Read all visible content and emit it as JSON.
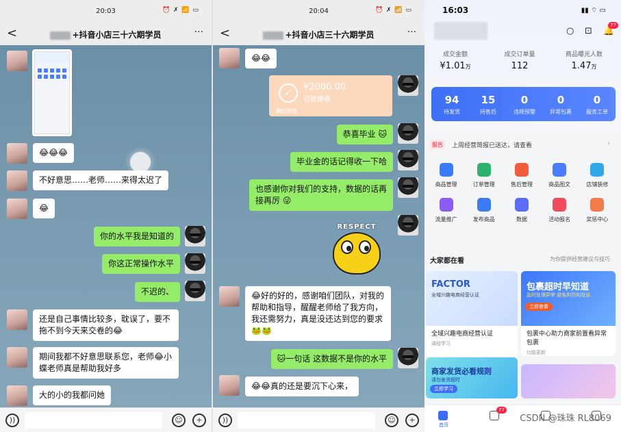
{
  "chat1": {
    "time": "20:03",
    "status_icons": "⏰ ✗ 📶 ▭",
    "title": "+抖音小店三十六期学员",
    "back": "<",
    "more": "···",
    "messages": [
      {
        "text": "😂😂😂"
      },
      {
        "text": "不好意思……老师……来得太迟了"
      },
      {
        "text": "😂"
      },
      {
        "text": "你的水平我是知道的"
      },
      {
        "text": "你这正常操作水平"
      },
      {
        "text": "不迟的、"
      },
      {
        "text": "还是自己事情比较多，耽误了，要不拖不到今天来交卷的😂"
      },
      {
        "text": "期间我都不好意思联系您，老师😂小蝶老师真是帮助我好多"
      },
      {
        "text": "大的小的我都问她"
      }
    ]
  },
  "chat2": {
    "time": "20:04",
    "status_icons": "⏰ ✗ 📶 ▭",
    "title": "+抖音小店三十六期学员",
    "back": "<",
    "more": "···",
    "first": "😂😂",
    "transfer": {
      "amount": "¥2000.00",
      "status": "已被接收",
      "footer": "微信转账"
    },
    "messages": [
      {
        "text": "恭喜毕业 🐱"
      },
      {
        "text": "毕业金的话记得收一下哈"
      },
      {
        "text": "也感谢你对我们的支持，数据的话再接再厉 😜"
      },
      {
        "text": "😂好的好的，感谢咱们团队，对我的帮助和指导，醒醒老师给了我方向，我还需努力，真是没还达到您的要求🐸🐸"
      },
      {
        "text": "🐱一句话 这数据不是你的水平"
      },
      {
        "text": "😂😂真的还是要沉下心来，"
      }
    ],
    "sticker_word": "RESPECT"
  },
  "input": {
    "voice": "))",
    "emoji": "☺",
    "plus": "+"
  },
  "app": {
    "time": "16:03",
    "status_icons": "▮▮ ⌔ ▭",
    "top_icons": [
      "○",
      "⊡",
      "🔔"
    ],
    "badge": "77",
    "metrics": [
      {
        "label": "成交金额",
        "value": "¥1.01",
        "unit": "万"
      },
      {
        "label": "成交订单量",
        "value": "112",
        "unit": ""
      },
      {
        "label": "商品曝光人数",
        "value": "1.47",
        "unit": "万"
      }
    ],
    "stats": [
      {
        "n": "94",
        "t": "待发货"
      },
      {
        "n": "15",
        "t": "待售后"
      },
      {
        "n": "0",
        "t": "违规预警"
      },
      {
        "n": "0",
        "t": "异常包裹"
      },
      {
        "n": "0",
        "t": "服务工单"
      }
    ],
    "notice": {
      "tag": "报告",
      "text": "上周经营简报已送达，请查看",
      "arrow": "›"
    },
    "tiles": [
      {
        "label": "商品管理",
        "color": "#3b7cf6"
      },
      {
        "label": "订单管理",
        "color": "#2db36b"
      },
      {
        "label": "售后管理",
        "color": "#f25c3c"
      },
      {
        "label": "商品图文",
        "color": "#4a7dfc"
      },
      {
        "label": "店铺装修",
        "color": "#2fa6e8"
      },
      {
        "label": "流量推广",
        "color": "#8a5cf5"
      },
      {
        "label": "发布商品",
        "color": "#3b7cf6"
      },
      {
        "label": "数据",
        "color": "#5b6cf5"
      },
      {
        "label": "活动报名",
        "color": "#f24a5a"
      },
      {
        "label": "奖惩中心",
        "color": "#f27b4a"
      }
    ],
    "section_title": "大家都在看",
    "section_hint": "为你提供经营建议与技巧",
    "cards": [
      {
        "banner_title": "FACTOR",
        "banner_sub": "全域兴趣电商经营认证",
        "title": "全域兴趣电商经营认证",
        "sub": "课程学习"
      },
      {
        "banner_title": "包裹超时早知道",
        "banner_sub": "及时处理异常 避免判罚和投诉",
        "pill": "立即查看",
        "title": "包裹中心助力商家前置看异常包裹",
        "sub": "功能更新"
      },
      {
        "banner_title": "商家发货必看规则",
        "banner_sub": "请勿发货超时",
        "pill": "立即学习",
        "title": "",
        "sub": ""
      }
    ],
    "nav": {
      "home": "首页",
      "msg_badge": "77"
    },
    "watermark": "CSDN @珠珠 RL8069"
  }
}
